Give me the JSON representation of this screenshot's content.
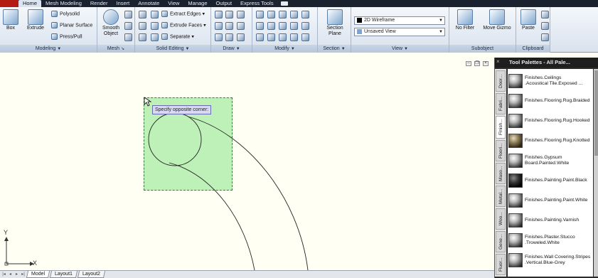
{
  "ribbon_tabs": [
    "Home",
    "Mesh Modeling",
    "Render",
    "Insert",
    "Annotate",
    "View",
    "Manage",
    "Output",
    "Express Tools"
  ],
  "modeling": {
    "title": "Modeling",
    "box": "Box",
    "extrude": "Extrude",
    "polysolid": "Polysolid",
    "planar_surface": "Planar Surface",
    "press_pull": "Press/Pull"
  },
  "mesh": {
    "title": "Mesh",
    "smooth_object_1": "Smooth",
    "smooth_object_2": "Object"
  },
  "solid_editing": {
    "title": "Solid Editing",
    "extract_edges": "Extract Edges",
    "extrude_faces": "Extrude Faces",
    "separate": "Separate"
  },
  "draw": {
    "title": "Draw"
  },
  "modify": {
    "title": "Modify"
  },
  "section": {
    "title": "Section",
    "section_plane_1": "Section",
    "section_plane_2": "Plane"
  },
  "view": {
    "title": "View",
    "visual_style": "2D Wireframe",
    "saved_view": "Unsaved View"
  },
  "subobject": {
    "title": "Subobject",
    "no_filter": "No Filter",
    "move_gizmo": "Move Gizmo"
  },
  "clipboard": {
    "title": "Clipboard",
    "paste": "Paste"
  },
  "drawing": {
    "tooltip": "Specify opposite corner:",
    "axis_x": "X",
    "axis_y": "Y"
  },
  "layout_tabs": [
    "Model",
    "Layout1",
    "Layout2"
  ],
  "palette": {
    "title": "Tool Palettes - All Pale...",
    "tabs": [
      "Door...",
      "Fabri...",
      "Finish...",
      "Floori...",
      "Maso...",
      "Metal...",
      "Woo...",
      "Gene...",
      "Fluor..."
    ],
    "items": [
      {
        "line1": "Finishes.Ceilings",
        "line2": ".Acoustical Tile.Exposed ..."
      },
      {
        "line1": "Finishes.Flooring.Rug.Braided",
        "line2": ""
      },
      {
        "line1": "Finishes.Flooring.Rug.Hooked",
        "line2": ""
      },
      {
        "line1": "Finishes.Flooring.Rug.Knotted",
        "line2": ""
      },
      {
        "line1": "Finishes.Gypsum",
        "line2": "Board.Painted.White"
      },
      {
        "line1": "Finishes.Painting.Paint.Black",
        "line2": ""
      },
      {
        "line1": "Finishes.Painting.Paint.White",
        "line2": ""
      },
      {
        "line1": "Finishes.Painting.Varnish",
        "line2": ""
      },
      {
        "line1": "Finishes.Plaster.Stucco",
        "line2": ".Troweled.White"
      },
      {
        "line1": "Finishes.Wall Covering.Stripes",
        "line2": ".Vertical.Blue-Grey"
      }
    ]
  },
  "colors": {
    "accent": "#1a2230",
    "selection": "#6ee16e"
  }
}
